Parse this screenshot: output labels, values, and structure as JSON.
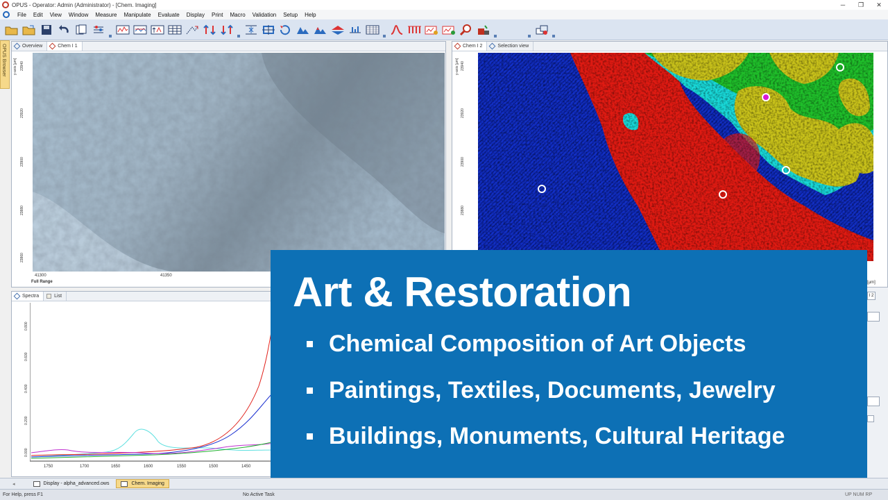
{
  "window": {
    "title": "OPUS - Operator: Admin  (Administrator) - [Chem. Imaging]",
    "controls": [
      "minimize",
      "restore",
      "close"
    ]
  },
  "menu": {
    "items": [
      "File",
      "Edit",
      "View",
      "Window",
      "Measure",
      "Manipulate",
      "Evaluate",
      "Display",
      "Print",
      "Macro",
      "Validation",
      "Setup",
      "Help"
    ]
  },
  "browser_strip": {
    "label": "OPUS Browser"
  },
  "top_left_pane": {
    "tabs": [
      "Overview",
      "Chem I 1"
    ],
    "y_axis_label": "y-axis [µm]",
    "y_ticks": [
      "23940",
      "23920",
      "23900",
      "23880",
      "23860"
    ],
    "x_ticks": [
      "41300",
      "41350"
    ],
    "range_label": "Full Range"
  },
  "top_right_pane": {
    "tabs": [
      "Chem I 2",
      "Selection view"
    ],
    "y_axis_label": "y-axis [µm]",
    "y_ticks": [
      "23940",
      "23920",
      "23900",
      "23880",
      "23860"
    ],
    "x_unit_fragment": "[µm]",
    "tab_fragment": "I 2"
  },
  "spectra_pane": {
    "tabs": [
      "Spectra",
      "List"
    ],
    "y_ticks": [
      "0.800",
      "0.600",
      "0.400",
      "0.200",
      "0.000"
    ],
    "x_ticks": [
      "1750",
      "1700",
      "1650",
      "1600",
      "1550",
      "1500",
      "1450"
    ]
  },
  "overlay": {
    "headline": "Art & Restoration",
    "bullets": [
      "Chemical Composition of Art Objects",
      "Paintings, Textiles, Documents, Jewelry",
      "Buildings, Monuments, Cultural Heritage"
    ],
    "background": "#0d70b5"
  },
  "taskbar": {
    "tasks": [
      "Display - alpha_advanced.ows",
      "Chem. Imaging"
    ]
  },
  "statusbar": {
    "help": "For Help, press F1",
    "task": "No Active Task",
    "indicators": "UP  NUM  RP"
  }
}
